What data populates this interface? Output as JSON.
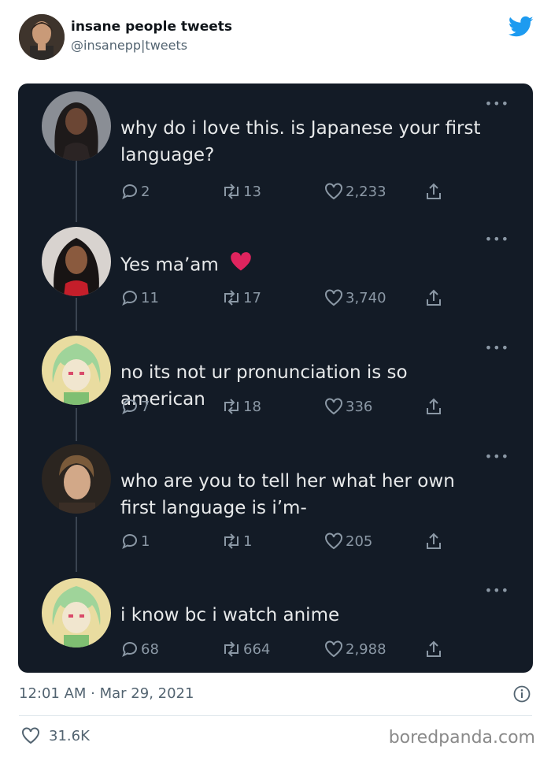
{
  "tweet": {
    "display_name": "insane people tweets",
    "handle": "@insanepp|tweets",
    "timestamp": "12:01 AM · Mar 29, 2021",
    "likes": "31.6K"
  },
  "watermark": "boredpanda.com",
  "more_glyph": "•••",
  "colors": {
    "card_bg": "#131b26",
    "twitter_blue": "#1d9bf0",
    "heart_red": "#e0245e"
  },
  "thread": [
    {
      "text": "why do i love this. is Japanese your first language?",
      "replies": "2",
      "retweets": "13",
      "likes": "2,233",
      "avatar": "woman-long-hair-avatar"
    },
    {
      "text": "Yes ma’am",
      "emoji": "❤️",
      "replies": "11",
      "retweets": "17",
      "likes": "3,740",
      "avatar": "woman-dark-hair-avatar"
    },
    {
      "text": "no its not ur pronunciation is so american",
      "replies": "7",
      "retweets": "18",
      "likes": "336",
      "avatar": "anime-green-hair-avatar"
    },
    {
      "text": "who are you to tell her what her own first language is i’m-",
      "replies": "1",
      "retweets": "1",
      "likes": "205",
      "avatar": "man-face-avatar"
    },
    {
      "text": "i know bc i watch anime",
      "replies": "68",
      "retweets": "664",
      "likes": "2,988",
      "avatar": "anime-green-hair-avatar"
    }
  ]
}
